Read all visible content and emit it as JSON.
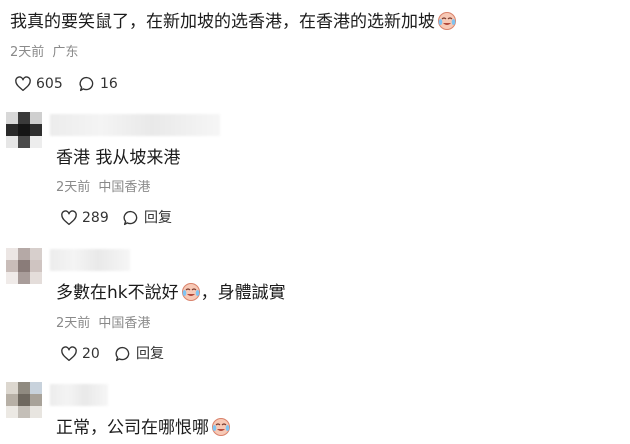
{
  "post": {
    "text": "我真的要笑鼠了，在新加坡的选香港，在香港的选新加坡",
    "time": "2天前",
    "location": "广东",
    "likes": "605",
    "comments": "16"
  },
  "replies": [
    {
      "text": "香港 我从坡来港",
      "time": "2天前",
      "location": "中国香港",
      "likes": "289",
      "reply_label": "回复"
    },
    {
      "text_before": "多數在hk不說好",
      "text_after": "，身體誠實",
      "time": "2天前",
      "location": "中国香港",
      "likes": "20",
      "reply_label": "回复"
    },
    {
      "text": "正常，公司在哪恨哪"
    }
  ],
  "icons": {
    "like": "heart-outline-icon",
    "comment": "speech-bubble-icon",
    "emoji": "laughing-crying-emoji-icon"
  },
  "colors": {
    "text": "#1b1b1b",
    "meta": "#8a8a8a",
    "icon": "#333333"
  }
}
